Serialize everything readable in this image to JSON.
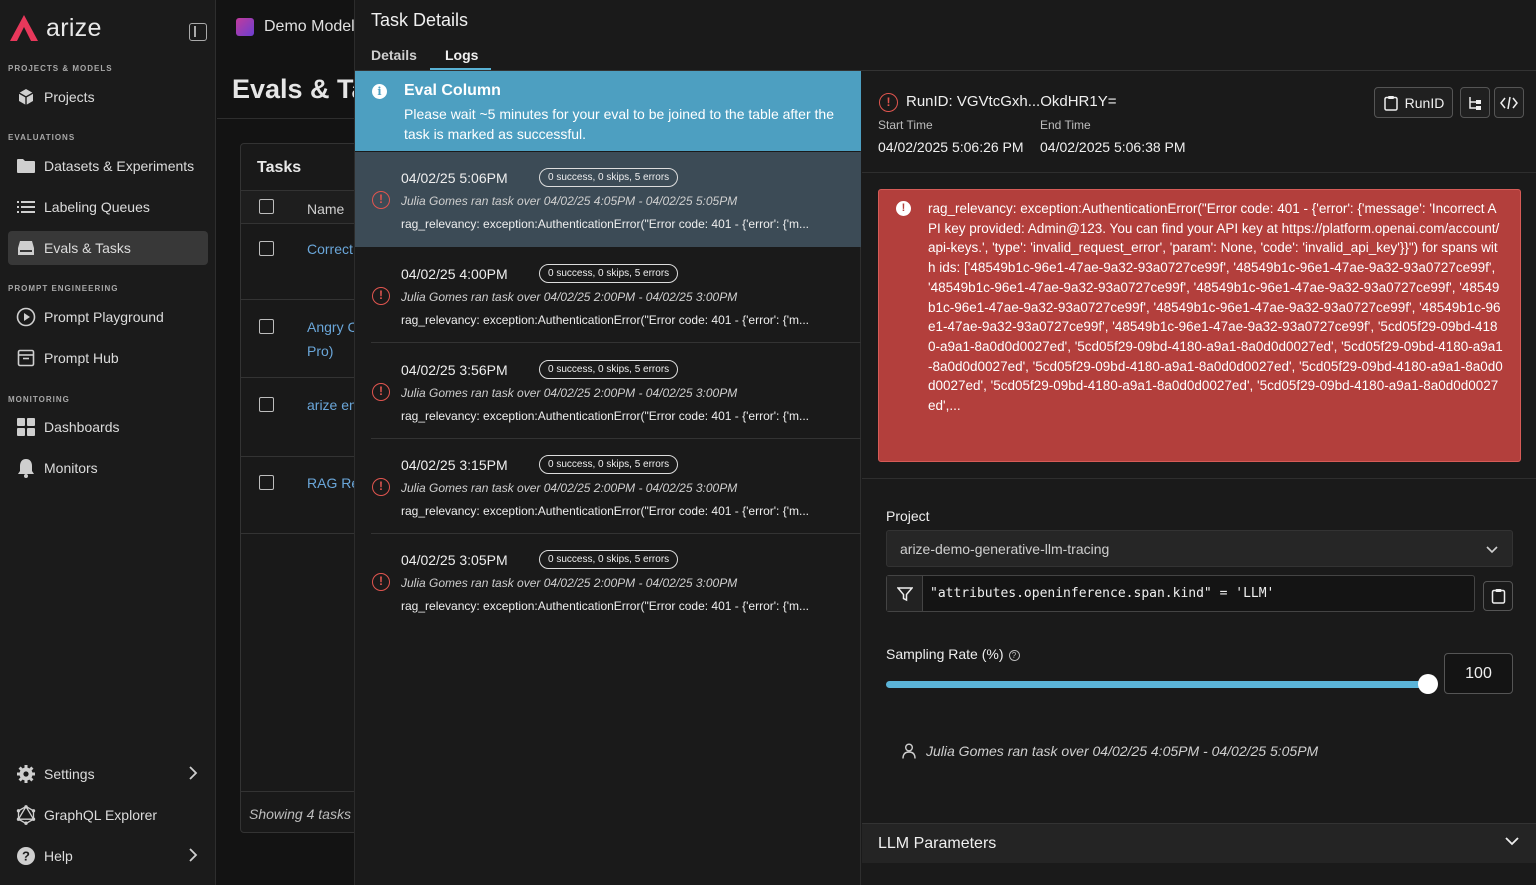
{
  "app": {
    "logo_text": "arize",
    "brand_color": "#e8385b"
  },
  "sidebar": {
    "sections": {
      "projects": "PROJECTS & MODELS",
      "evaluations": "EVALUATIONS",
      "prompt": "PROMPT ENGINEERING",
      "monitoring": "MONITORING"
    },
    "items": [
      {
        "label": "Projects",
        "icon": "cube-icon"
      },
      {
        "label": "Datasets & Experiments",
        "icon": "folder-icon"
      },
      {
        "label": "Labeling Queues",
        "icon": "list-icon"
      },
      {
        "label": "Evals & Tasks",
        "icon": "drive-icon",
        "active": true
      },
      {
        "label": "Prompt Playground",
        "icon": "play-icon"
      },
      {
        "label": "Prompt Hub",
        "icon": "archive-icon"
      },
      {
        "label": "Dashboards",
        "icon": "grid-icon"
      },
      {
        "label": "Monitors",
        "icon": "bell-icon"
      },
      {
        "label": "Settings",
        "icon": "gear-icon"
      },
      {
        "label": "GraphQL Explorer",
        "icon": "graphql-icon"
      },
      {
        "label": "Help",
        "icon": "help-icon"
      }
    ]
  },
  "background_page": {
    "model_name": "Demo Model",
    "title": "Evals & Ta",
    "tasks_title": "Tasks",
    "name_header": "Name",
    "rows": [
      "Correct",
      "Angry C",
      "Pro)",
      "arize en",
      "RAG Re"
    ],
    "footer": "Showing 4 tasks"
  },
  "panel": {
    "title": "Task Details",
    "tabs": [
      "Details",
      "Logs"
    ],
    "active_tab": "Logs",
    "banner": {
      "title": "Eval Column",
      "text": "Please wait ~5 minutes for your eval to be joined to the table after the task is marked as successful."
    },
    "logs": [
      {
        "time": "04/02/25 5:06PM",
        "badge": "0 success, 0 skips, 5 errors",
        "sub": "Julia Gomes ran task over 04/02/25 4:05PM - 04/02/25 5:05PM",
        "msg": "rag_relevancy: exception:AuthenticationError(\"Error code: 401 - {'error': {'m..."
      },
      {
        "time": "04/02/25 4:00PM",
        "badge": "0 success, 0 skips, 5 errors",
        "sub": "Julia Gomes ran task over 04/02/25 2:00PM - 04/02/25 3:00PM",
        "msg": "rag_relevancy: exception:AuthenticationError(\"Error code: 401 - {'error': {'m..."
      },
      {
        "time": "04/02/25 3:56PM",
        "badge": "0 success, 0 skips, 5 errors",
        "sub": "Julia Gomes ran task over 04/02/25 2:00PM - 04/02/25 3:00PM",
        "msg": "rag_relevancy: exception:AuthenticationError(\"Error code: 401 - {'error': {'m..."
      },
      {
        "time": "04/02/25 3:15PM",
        "badge": "0 success, 0 skips, 5 errors",
        "sub": "Julia Gomes ran task over 04/02/25 2:00PM - 04/02/25 3:00PM",
        "msg": "rag_relevancy: exception:AuthenticationError(\"Error code: 401 - {'error': {'m..."
      },
      {
        "time": "04/02/25 3:05PM",
        "badge": "0 success, 0 skips, 5 errors",
        "sub": "Julia Gomes ran task over 04/02/25 2:00PM - 04/02/25 3:00PM",
        "msg": "rag_relevancy: exception:AuthenticationError(\"Error code: 401 - {'error': {'m..."
      }
    ]
  },
  "detail": {
    "run_id": "RunID: VGVtcGxh...OkdHR1Y=",
    "runid_button": "RunID",
    "start_label": "Start Time",
    "start_value": "04/02/2025 5:06:26 PM",
    "end_label": "End Time",
    "end_value": "04/02/2025 5:06:38 PM",
    "error_text": "rag_relevancy: exception:AuthenticationError(\"Error code: 401 - {'error': {'message': 'Incorrect API key provided: Admin@123. You can find your API key at https://platform.openai.com/account/api-keys.', 'type': 'invalid_request_error', 'param': None, 'code': 'invalid_api_key'}}\") for spans with ids: ['48549b1c-96e1-47ae-9a32-93a0727ce99f', '48549b1c-96e1-47ae-9a32-93a0727ce99f', '48549b1c-96e1-47ae-9a32-93a0727ce99f', '48549b1c-96e1-47ae-9a32-93a0727ce99f', '48549b1c-96e1-47ae-9a32-93a0727ce99f', '48549b1c-96e1-47ae-9a32-93a0727ce99f', '48549b1c-96e1-47ae-9a32-93a0727ce99f', '48549b1c-96e1-47ae-9a32-93a0727ce99f', '5cd05f29-09bd-4180-a9a1-8a0d0d0027ed', '5cd05f29-09bd-4180-a9a1-8a0d0d0027ed', '5cd05f29-09bd-4180-a9a1-8a0d0d0027ed', '5cd05f29-09bd-4180-a9a1-8a0d0d0027ed', '5cd05f29-09bd-4180-a9a1-8a0d0d0027ed', '5cd05f29-09bd-4180-a9a1-8a0d0d0027ed', '5cd05f29-09bd-4180-a9a1-8a0d0d0027ed',...",
    "project_label": "Project",
    "project_value": "arize-demo-generative-llm-tracing",
    "filter_value": "\"attributes.openinference.span.kind\" = 'LLM'",
    "sampling_label": "Sampling Rate (%)",
    "sampling_value": "100",
    "sampling_fraction": 1.0,
    "user_line": "Julia Gomes ran task over 04/02/25 4:05PM - 04/02/25 5:05PM",
    "llm_params": "LLM Parameters"
  }
}
